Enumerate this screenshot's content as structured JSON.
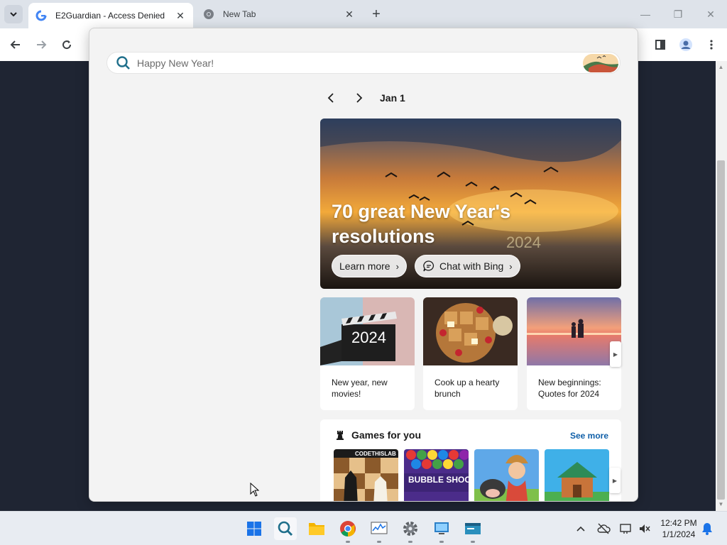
{
  "browser": {
    "tabs": [
      {
        "title": "E2Guardian - Access Denied",
        "active": true,
        "icon": "google-g-icon"
      },
      {
        "title": "New Tab",
        "active": false,
        "icon": "chrome-icon"
      }
    ],
    "new_tab_label": "+",
    "window_controls": [
      "minimize-icon",
      "restore-icon",
      "close-icon"
    ]
  },
  "search": {
    "placeholder": "Happy New Year!"
  },
  "date_nav": {
    "date": "Jan 1"
  },
  "hero": {
    "title": "70 great New Year's resolutions",
    "learn_more": "Learn more",
    "chat_with_bing": "Chat with Bing"
  },
  "cards": [
    {
      "caption": "New year, new movies!"
    },
    {
      "caption": "Cook up a hearty brunch"
    },
    {
      "caption": "New beginnings: Quotes for 2024"
    }
  ],
  "games": {
    "title": "Games for you",
    "see_more": "See more",
    "items": [
      "CODETHISLAB",
      "BUBBLE SHOOTER HD",
      "farm",
      "house"
    ]
  },
  "taskbar": {
    "time": "12:42 PM",
    "date": "1/1/2024"
  },
  "colors": {
    "accent": "#0f5fa8",
    "flyout_bg": "#f3f3f3",
    "page_bg": "#1f2533"
  }
}
